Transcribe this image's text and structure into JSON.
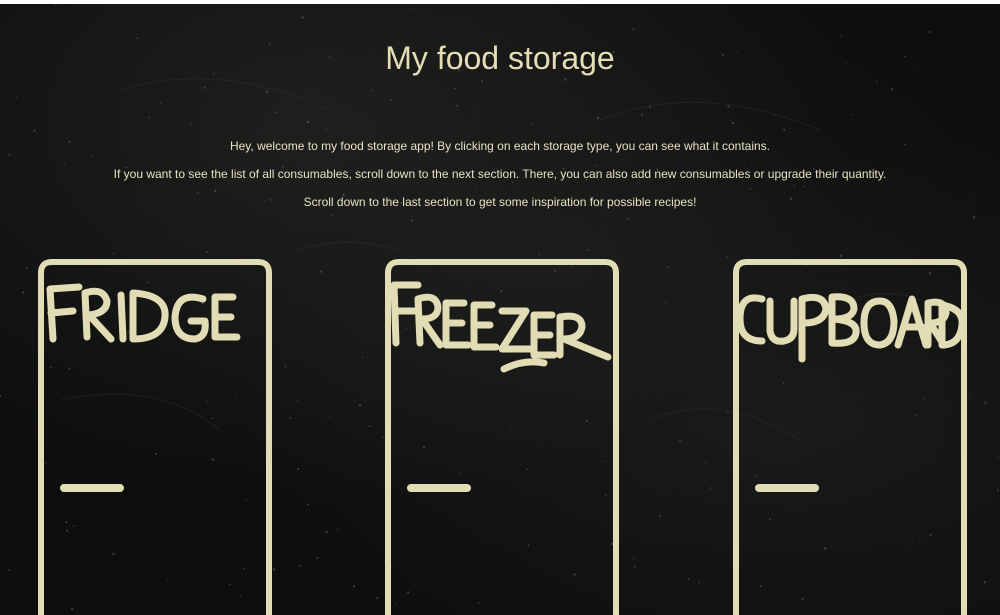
{
  "page": {
    "title": "My food storage"
  },
  "intro": {
    "lines": [
      "Hey, welcome to my food storage app! By clicking on each storage type, you can see what it contains.",
      "If you want to see the list of all consumables, scroll down to the next section. There, you can also add new consumables or upgrade their quantity.",
      "Scroll down to the last section to get some inspiration for possible recipes!"
    ]
  },
  "storages": [
    {
      "label": "FRIDGE"
    },
    {
      "label": "FREEZER"
    },
    {
      "label": "CUPBOARD"
    }
  ],
  "colors": {
    "background": "#0d0e0d",
    "chalk": "#e2dcb4"
  }
}
